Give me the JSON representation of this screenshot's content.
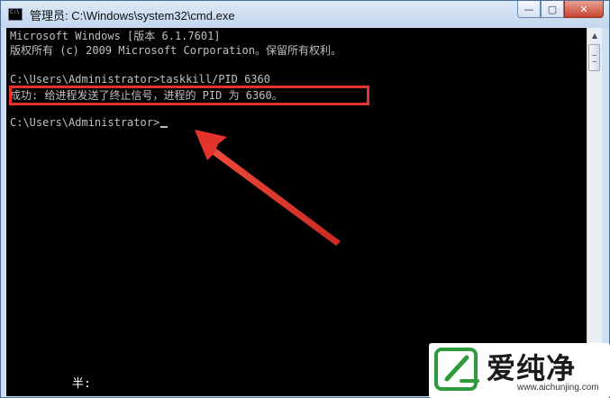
{
  "window": {
    "title": "管理员: C:\\Windows\\system32\\cmd.exe",
    "minimize_glyph": "—",
    "maximize_glyph": "▢",
    "close_glyph": "✕"
  },
  "console": {
    "lines": [
      "Microsoft Windows [版本 6.1.7601]",
      "版权所有 (c) 2009 Microsoft Corporation。保留所有权利。",
      "",
      "C:\\Users\\Administrator>taskkill/PID 6360",
      "成功: 给进程发送了终止信号，进程的 PID 为 6360。",
      "",
      "C:\\Users\\Administrator>"
    ],
    "ime_status": "半:"
  },
  "annotations": {
    "highlight_color": "#e5322d",
    "arrow_color": "#e5322d"
  },
  "watermark": {
    "brand": "爱纯净",
    "url": "www.aichunjing.com"
  }
}
